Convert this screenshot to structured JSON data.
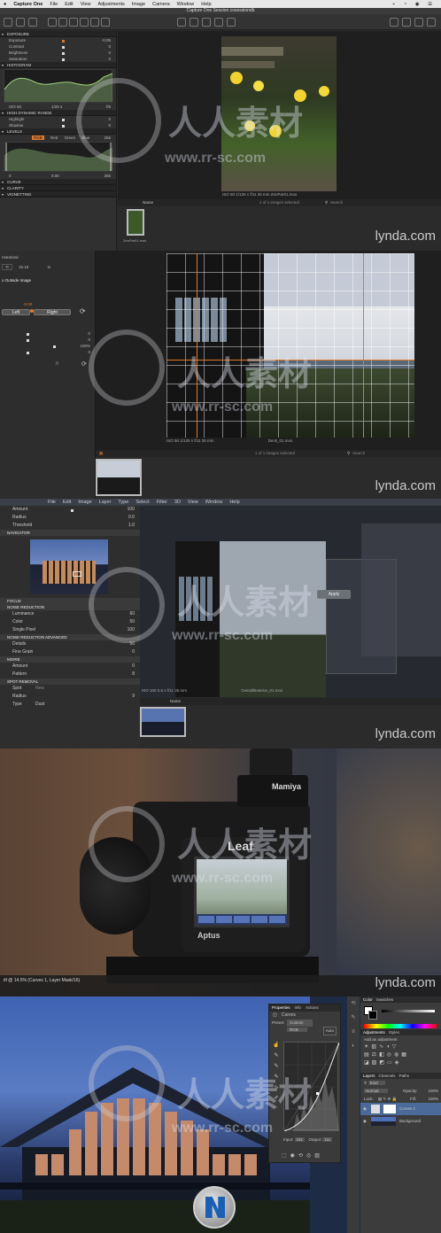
{
  "colors": {
    "accent_orange": "#e07a2a",
    "panel_bg": "#2a2a2a",
    "lynda": "#dddddd",
    "sky": "#2c4a8c"
  },
  "panel1": {
    "menubar": {
      "app": "Capture One",
      "items": [
        "File",
        "Edit",
        "View",
        "Adjustments",
        "Image",
        "Camera",
        "Window",
        "Help"
      ]
    },
    "window_title": "Capture One Session.cosessiondb",
    "sections": {
      "exposure": "EXPOSURE",
      "histogram": "HISTOGRAM",
      "hdr": "HIGH DYNAMIC RANGE",
      "levels": "LEVELS",
      "curve": "CURVE",
      "clarity": "CLARITY",
      "vignetting": "VIGNETTING"
    },
    "exposure_rows": [
      {
        "label": "Exposure",
        "value": "-0.05"
      },
      {
        "label": "Contrast",
        "value": "0"
      },
      {
        "label": "Brightness",
        "value": "0"
      },
      {
        "label": "Saturation",
        "value": "0"
      }
    ],
    "hist_info": {
      "iso": "ISO 50",
      "shutter": "1/25 s",
      "aperture": "f/8"
    },
    "hdr_rows": [
      {
        "label": "Highlight",
        "value": "0"
      },
      {
        "label": "Shadow",
        "value": "0"
      }
    ],
    "levels_tabs": [
      "RGB",
      "Red",
      "Green",
      "Blue"
    ],
    "levels_values": {
      "low": "0",
      "mid": "0.00",
      "high": "255"
    },
    "viewer_status": {
      "iso": "ISO 50",
      "shutter": "1/125 s",
      "aperture": "f/11",
      "focal": "35 mm",
      "filename": "ZenPar01.mos"
    },
    "browser": {
      "count": "1 of 1 images selected",
      "search": "Search",
      "col_name": "Name",
      "thumb_name": "ZenPar01.mos"
    },
    "lynda": "lynda.com"
  },
  "panel2": {
    "constrained": "nstrained",
    "rotation": "15.19",
    "unit": "in",
    "outside_label": "o Outside Image",
    "value_orange": "-0.00",
    "left_btn": "Left",
    "right_btn": "Right",
    "slider_values": [
      "0",
      "0",
      "100%",
      "0"
    ],
    "status": {
      "iso": "ISO 50",
      "shutter": "1/125 s",
      "aperture": "f/11",
      "focal": "35 mm",
      "filename": "Deck_01.mos"
    },
    "count": "1 of 1 images selected",
    "search": "Search",
    "lynda": "lynda.com"
  },
  "panel3": {
    "menubar": [
      "File",
      "Edit",
      "Image",
      "Layer",
      "Type",
      "Select",
      "Filter",
      "3D",
      "View",
      "Window",
      "Help"
    ],
    "amount": {
      "label": "Amount",
      "value": "100"
    },
    "radius": {
      "label": "Radius",
      "value": "0.6"
    },
    "threshold": {
      "label": "Threshold",
      "value": "1.0"
    },
    "navigator": "NAVIGATOR",
    "focus": "FOCUS",
    "noise_reduction": "NOISE REDUCTION",
    "luminance": {
      "label": "Luminance",
      "value": "60"
    },
    "color": {
      "label": "Color",
      "value": "50"
    },
    "single_pixel": {
      "label": "Single Pixel",
      "value": "100"
    },
    "nr_advanced": "NOISE REDUCTION ADVANCED",
    "details": {
      "label": "Details",
      "value": "50"
    },
    "fine_grain": {
      "label": "Fine Grain",
      "value": "0"
    },
    "moire": "MOIRE",
    "moire_amount": {
      "label": "Amount",
      "value": "0"
    },
    "pattern": {
      "label": "Pattern",
      "value": "8"
    },
    "spot_removal": "SPOT REMOVAL",
    "spot": {
      "label": "Spot",
      "value": "New"
    },
    "spot_radius": {
      "label": "Radius",
      "value": "9"
    },
    "spot_type": {
      "label": "Type",
      "value": "Dust"
    },
    "apply": "Apply",
    "status": {
      "iso": "ISO 100",
      "shutter": "0.6 s",
      "aperture": "f/11",
      "focal": "35 mm",
      "filename": "OverallExterior_01.mos"
    },
    "col_name": "Name",
    "lynda": "lynda.com"
  },
  "panel4": {
    "brand_mamiya": "Mamiya",
    "brand_leaf": "Leaf",
    "brand_aptus": "Aptus",
    "doc_title": "tif @ 14.5% (Curves 1, Layer Mask/16)",
    "lynda": "lynda.com"
  },
  "panel5": {
    "properties_tabs": [
      "Properties",
      "Info",
      "Actions"
    ],
    "curves": "Curves",
    "preset": {
      "label": "Preset:",
      "value": "Custom"
    },
    "channel": {
      "value": "RGB",
      "auto": "Auto"
    },
    "input": {
      "label": "Input:",
      "value": "151"
    },
    "output": {
      "label": "Output:",
      "value": "111"
    },
    "color_tabs": [
      "Color",
      "Swatches"
    ],
    "adjustments_tabs": [
      "Adjustments",
      "Styles"
    ],
    "add_adjustment": "Add an adjustment",
    "layers_tabs": [
      "Layers",
      "Channels",
      "Paths"
    ],
    "kind": "Kind",
    "blend": {
      "mode": "Normal",
      "opacity_label": "Opacity:",
      "opacity": "100%"
    },
    "lock": {
      "label": "Lock:",
      "fill_label": "Fill:",
      "fill": "100%"
    },
    "layers": [
      "Curves 1",
      "Background"
    ]
  },
  "watermark": {
    "cn": "人人素材",
    "url": "www.rr-sc.com"
  }
}
